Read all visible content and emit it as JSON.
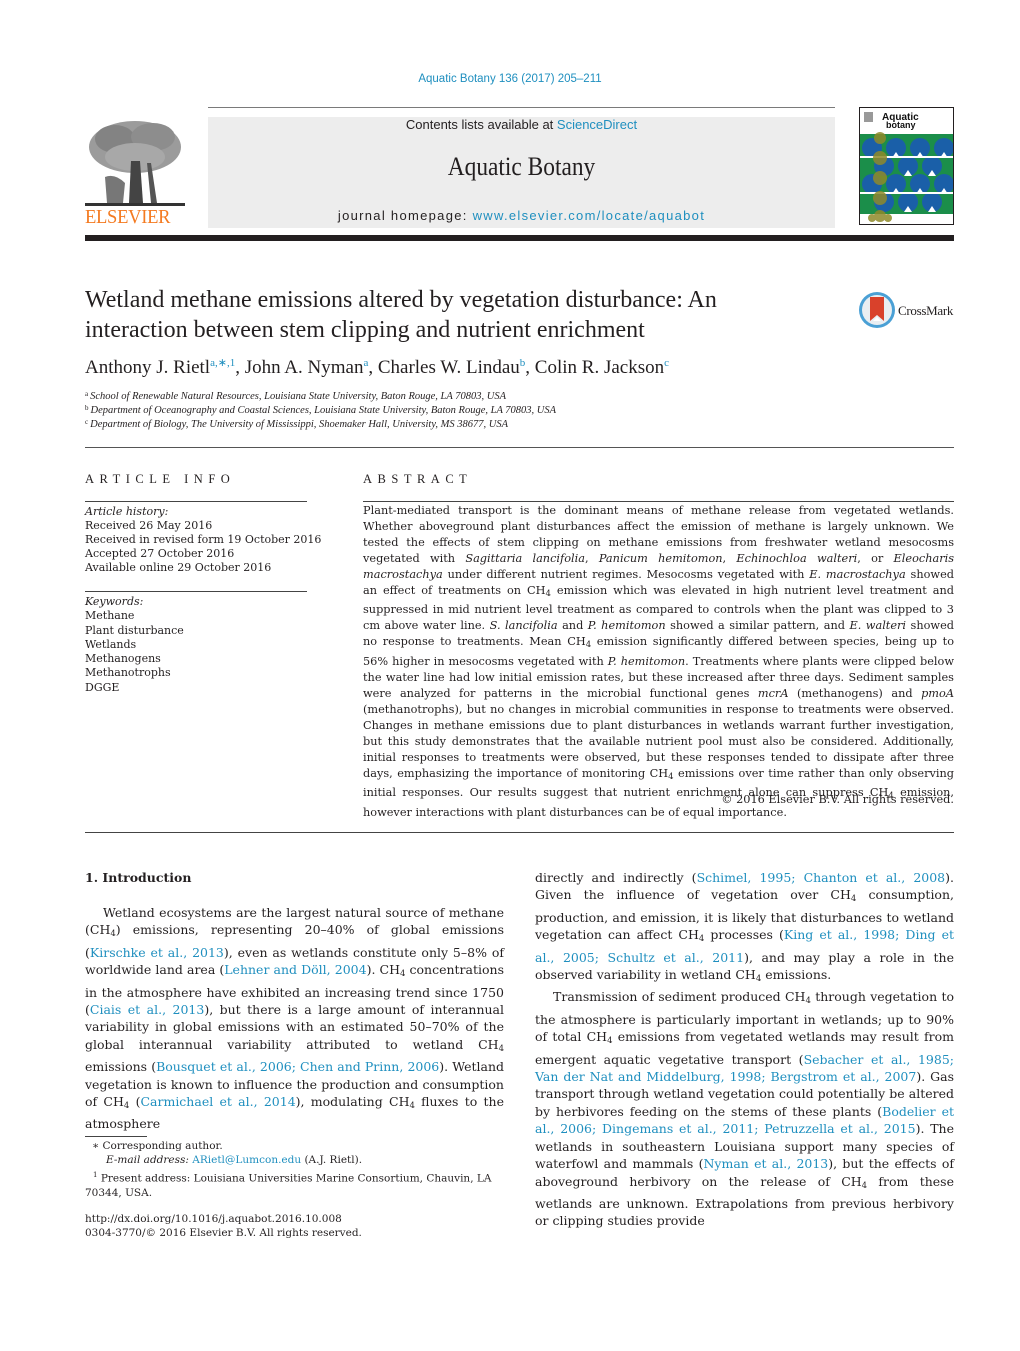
{
  "header": {
    "citation": "Aquatic Botany 136 (2017) 205–211",
    "contents_prefix": "Contents lists available at ",
    "contents_link": "ScienceDirect",
    "journal_name": "Aquatic Botany",
    "homepage_prefix": "journal homepage: ",
    "homepage_url": "www.elsevier.com/locate/aquabot",
    "publisher_logo_text": "ELSEVIER",
    "cover_title_line1": "Aquatic",
    "cover_title_line2": "botany",
    "crossmark_label": "CrossMark"
  },
  "article": {
    "title": "Wetland methane emissions altered by vegetation disturbance: An interaction between stem clipping and nutrient enrichment",
    "authors": [
      {
        "name": "Anthony J. Rietl",
        "sup": "a,∗,1"
      },
      {
        "name": "John A. Nyman",
        "sup": "a"
      },
      {
        "name": "Charles W. Lindau",
        "sup": "b"
      },
      {
        "name": "Colin R. Jackson",
        "sup": "c"
      }
    ],
    "affiliations": [
      {
        "key": "a",
        "text": "School of Renewable Natural Resources, Louisiana State University, Baton Rouge, LA 70803, USA"
      },
      {
        "key": "b",
        "text": "Department of Oceanography and Coastal Sciences, Louisiana State University, Baton Rouge, LA 70803, USA"
      },
      {
        "key": "c",
        "text": "Department of Biology, The University of Mississippi, Shoemaker Hall, University, MS 38677, USA"
      }
    ]
  },
  "article_info": {
    "heading": "ARTICLE INFO",
    "history_label": "Article history:",
    "history": [
      "Received 26 May 2016",
      "Received in revised form 19 October 2016",
      "Accepted 27 October 2016",
      "Available online 29 October 2016"
    ],
    "keywords_label": "Keywords:",
    "keywords": [
      "Methane",
      "Plant disturbance",
      "Wetlands",
      "Methanogens",
      "Methanotrophs",
      "DGGE"
    ]
  },
  "abstract": {
    "heading": "ABSTRACT",
    "parts": [
      {
        "t": "Plant-mediated transport is the dominant means of methane release from vegetated wetlands. Whether aboveground plant disturbances affect the emission of methane is largely unknown. We tested the effects of stem clipping on methane emissions from freshwater wetland mesocosms vegetated with "
      },
      {
        "i": "Sagittaria lancifolia"
      },
      {
        "t": ", "
      },
      {
        "i": "Panicum hemitomon"
      },
      {
        "t": ", "
      },
      {
        "i": "Echinochloa walteri"
      },
      {
        "t": ", or "
      },
      {
        "i": "Eleocharis macrostachya"
      },
      {
        "t": " under different nutrient regimes. Mesocosms vegetated with "
      },
      {
        "i": "E. macrostachya"
      },
      {
        "t": " showed an effect of treatments on CH"
      },
      {
        "s": "4"
      },
      {
        "t": " emission which was elevated in high nutrient level treatment and suppressed in mid nutrient level treatment as compared to controls when the plant was clipped to 3 cm above water line. "
      },
      {
        "i": "S. lancifolia"
      },
      {
        "t": " and "
      },
      {
        "i": "P. hemitomon"
      },
      {
        "t": " showed a similar pattern, and "
      },
      {
        "i": "E. walteri"
      },
      {
        "t": " showed no response to treatments. Mean CH"
      },
      {
        "s": "4"
      },
      {
        "t": " emission significantly differed between species, being up to 56% higher in mesocosms vegetated with "
      },
      {
        "i": "P. hemitomon"
      },
      {
        "t": ". Treatments where plants were clipped below the water line had low initial emission rates, but these increased after three days. Sediment samples were analyzed for patterns in the microbial functional genes "
      },
      {
        "i": "mcrA"
      },
      {
        "t": " (methanogens) and "
      },
      {
        "i": "pmoA"
      },
      {
        "t": " (methanotrophs), but no changes in microbial communities in response to treatments were observed. Changes in methane emissions due to plant disturbances in wetlands warrant further investigation, but this study demonstrates that the available nutrient pool must also be considered. Additionally, initial responses to treatments were observed, but these responses tended to dissipate after three days, emphasizing the importance of monitoring CH"
      },
      {
        "s": "4"
      },
      {
        "t": " emissions over time rather than only observing initial responses. Our results suggest that nutrient enrichment alone can suppress CH"
      },
      {
        "s": "4"
      },
      {
        "t": " emission, however interactions with plant disturbances can be of equal importance."
      }
    ],
    "copyright": "© 2016 Elsevier B.V. All rights reserved."
  },
  "body": {
    "section_heading": "1.  Introduction",
    "col1": [
      {
        "t": "Wetland ecosystems are the largest natural source of methane (CH"
      },
      {
        "s": "4"
      },
      {
        "t": ") emissions, representing 20–40% of global emissions ("
      },
      {
        "l": "Kirschke et al., 2013"
      },
      {
        "t": "), even as wetlands constitute only 5–8% of worldwide land area ("
      },
      {
        "l": "Lehner and Döll, 2004"
      },
      {
        "t": "). CH"
      },
      {
        "s": "4"
      },
      {
        "t": " concentrations in the atmosphere have exhibited an increasing trend since 1750 ("
      },
      {
        "l": "Ciais et al., 2013"
      },
      {
        "t": "), but there is a large amount of interannual variability in global emissions with an estimated 50–70% of the global interannual variability attributed to wetland CH"
      },
      {
        "s": "4"
      },
      {
        "t": " emissions ("
      },
      {
        "l": "Bousquet et al., 2006; Chen and Prinn, 2006"
      },
      {
        "t": "). Wetland vegetation is known to influence the production and consumption of CH"
      },
      {
        "s": "4"
      },
      {
        "t": " ("
      },
      {
        "l": "Carmichael et al., 2014"
      },
      {
        "t": "), modulating CH"
      },
      {
        "s": "4"
      },
      {
        "t": " fluxes to the atmosphere"
      }
    ],
    "col2_p1": [
      {
        "t": "directly and indirectly ("
      },
      {
        "l": "Schimel, 1995; Chanton et al., 2008"
      },
      {
        "t": "). Given the influence of vegetation over CH"
      },
      {
        "s": "4"
      },
      {
        "t": " consumption, production, and emission, it is likely that disturbances to wetland vegetation can affect CH"
      },
      {
        "s": "4"
      },
      {
        "t": " processes ("
      },
      {
        "l": "King et al., 1998; Ding et al., 2005; Schultz et al., 2011"
      },
      {
        "t": "), and may play a role in the observed variability in wetland CH"
      },
      {
        "s": "4"
      },
      {
        "t": " emissions."
      }
    ],
    "col2_p2": [
      {
        "t": "Transmission of sediment produced CH"
      },
      {
        "s": "4"
      },
      {
        "t": " through vegetation to the atmosphere is particularly important in wetlands; up to 90% of total CH"
      },
      {
        "s": "4"
      },
      {
        "t": " emissions from vegetated wetlands may result from emergent aquatic vegetative transport ("
      },
      {
        "l": "Sebacher et al., 1985; Van der Nat and Middelburg, 1998; Bergstrom et al., 2007"
      },
      {
        "t": "). Gas transport through wetland vegetation could potentially be altered by herbivores feeding on the stems of these plants ("
      },
      {
        "l": "Bodelier et al., 2006; Dingemans et al., 2011; Petruzzella et al., 2015"
      },
      {
        "t": "). The wetlands in southeastern Louisiana support many species of waterfowl and mammals ("
      },
      {
        "l": "Nyman et al., 2013"
      },
      {
        "t": "), but the effects of aboveground herbivory on the release of CH"
      },
      {
        "s": "4"
      },
      {
        "t": " from these wetlands are unknown. Extrapolations from previous herbivory or clipping studies provide"
      }
    ]
  },
  "footnotes": {
    "corresponding_mark": "∗",
    "corresponding": "Corresponding author.",
    "email_label": "E-mail address:",
    "email": "ARietl@Lumcon.edu",
    "email_suffix": " (A.J. Rietl).",
    "present_mark": "1",
    "present": "Present address: Louisiana Universities Marine Consortium, Chauvin, LA 70344, USA.",
    "doi": "http://dx.doi.org/10.1016/j.aquabot.2016.10.008",
    "issn": "0304-3770/© 2016 Elsevier B.V. All rights reserved."
  },
  "colors": {
    "link": "#1f8fbf",
    "elsevier_orange": "#f47a20",
    "text": "#231f20",
    "journal_box": "#ededed"
  }
}
